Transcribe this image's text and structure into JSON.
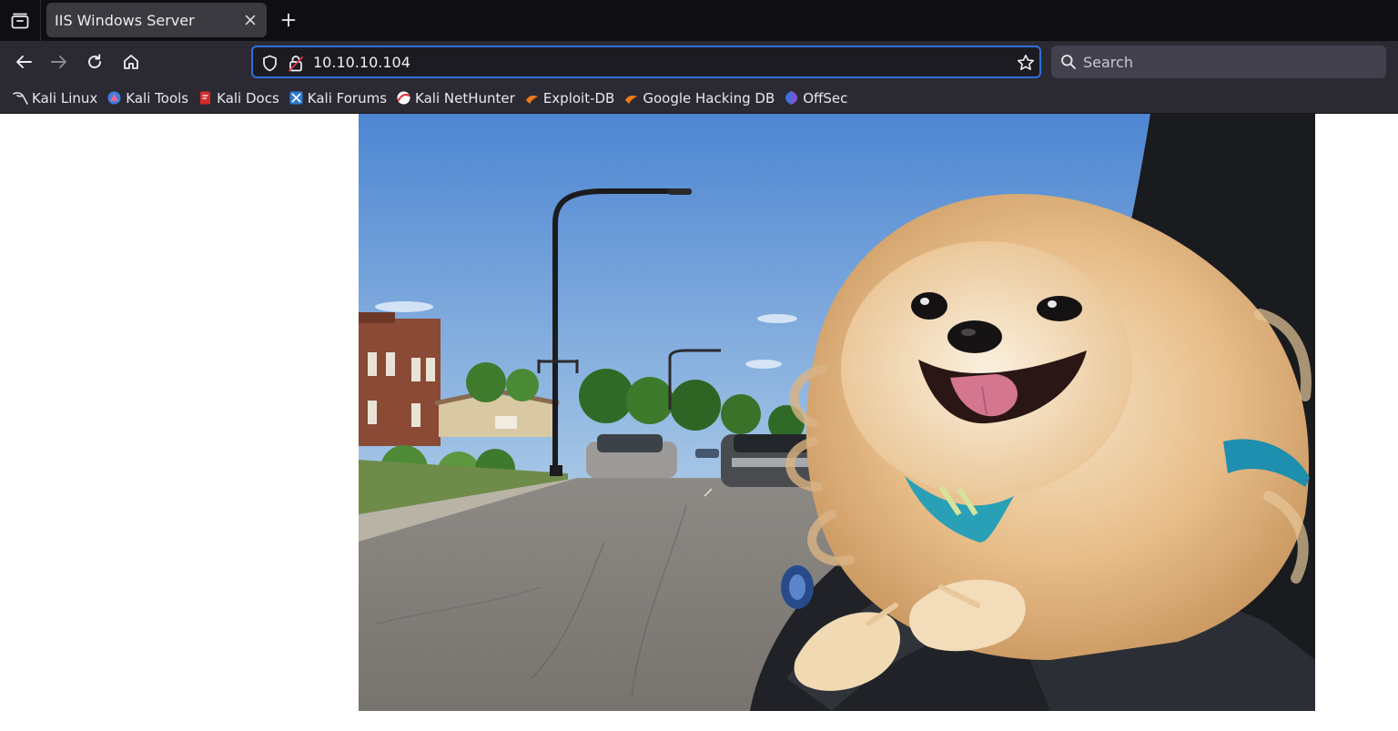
{
  "window": {
    "tab_title": "IIS Windows Server"
  },
  "navbar": {
    "url": "10.10.10.104",
    "search_placeholder": "Search"
  },
  "bookmarks": [
    {
      "label": "Kali Linux",
      "icon": "kali-dragon-icon"
    },
    {
      "label": "Kali Tools",
      "icon": "kali-tools-icon"
    },
    {
      "label": "Kali Docs",
      "icon": "kali-docs-icon"
    },
    {
      "label": "Kali Forums",
      "icon": "kali-forums-icon"
    },
    {
      "label": "Kali NetHunter",
      "icon": "kali-nethunter-icon"
    },
    {
      "label": "Exploit-DB",
      "icon": "exploit-db-icon"
    },
    {
      "label": "Google Hacking DB",
      "icon": "google-hacking-db-icon"
    },
    {
      "label": "OffSec",
      "icon": "offsec-icon"
    }
  ],
  "colors": {
    "tabbar_bg": "#0e0e13",
    "toolbar_bg": "#2b2a33",
    "urlbar_focus": "#2f6fd8",
    "page_bg": "#ffffff"
  },
  "content": {
    "image_subject": "pomeranian-dog-in-car-window"
  }
}
